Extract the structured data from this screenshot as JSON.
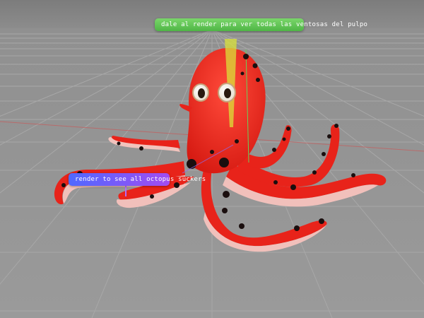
{
  "annotations": {
    "spanish_note": "dale al render para ver todas las ventosas del pulpo",
    "english_note": "render to see all octopus suckers"
  },
  "colors": {
    "octopus_body": "#e8231a",
    "octopus_spots": "#1a0e0e",
    "underside": "#f1c0bb",
    "grid_floor": "#8f8f8f",
    "grid_lines": "#a9a9a9",
    "spanish_note_bg": "#5cc24f",
    "english_note_bg_start": "#4f69ff",
    "english_note_bg_end": "#a24cf2"
  },
  "scene": {
    "object": "octopus-model",
    "view": "3d-viewport-perspective"
  }
}
